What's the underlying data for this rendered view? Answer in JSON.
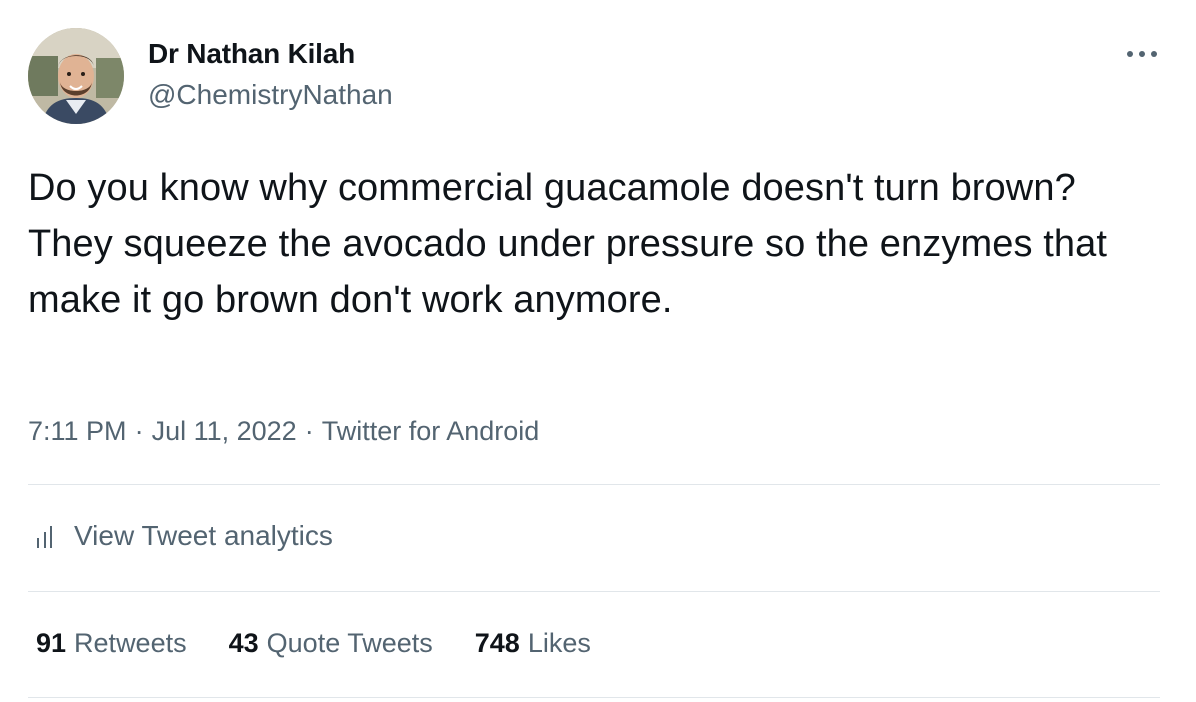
{
  "author": {
    "display_name": "Dr Nathan Kilah",
    "handle": "@ChemistryNathan",
    "avatar_icon": "profile-photo"
  },
  "more_icon": "more-horizontal-icon",
  "tweet": {
    "text": "Do you know why commercial guacamole doesn't turn brown? They squeeze the avocado under pressure so the enzymes that make it go brown don't work anymore."
  },
  "meta": {
    "time": "7:11 PM",
    "separator": "·",
    "date": "Jul 11, 2022",
    "source": "Twitter for Android"
  },
  "analytics": {
    "icon": "analytics-bars-icon",
    "label": "View Tweet analytics"
  },
  "stats": [
    {
      "count": "91",
      "label": "Retweets"
    },
    {
      "count": "43",
      "label": "Quote Tweets"
    },
    {
      "count": "748",
      "label": "Likes"
    }
  ],
  "colors": {
    "primary_text": "#0f1419",
    "secondary_text": "#536471",
    "divider": "#e1e6ea",
    "background": "#ffffff"
  }
}
